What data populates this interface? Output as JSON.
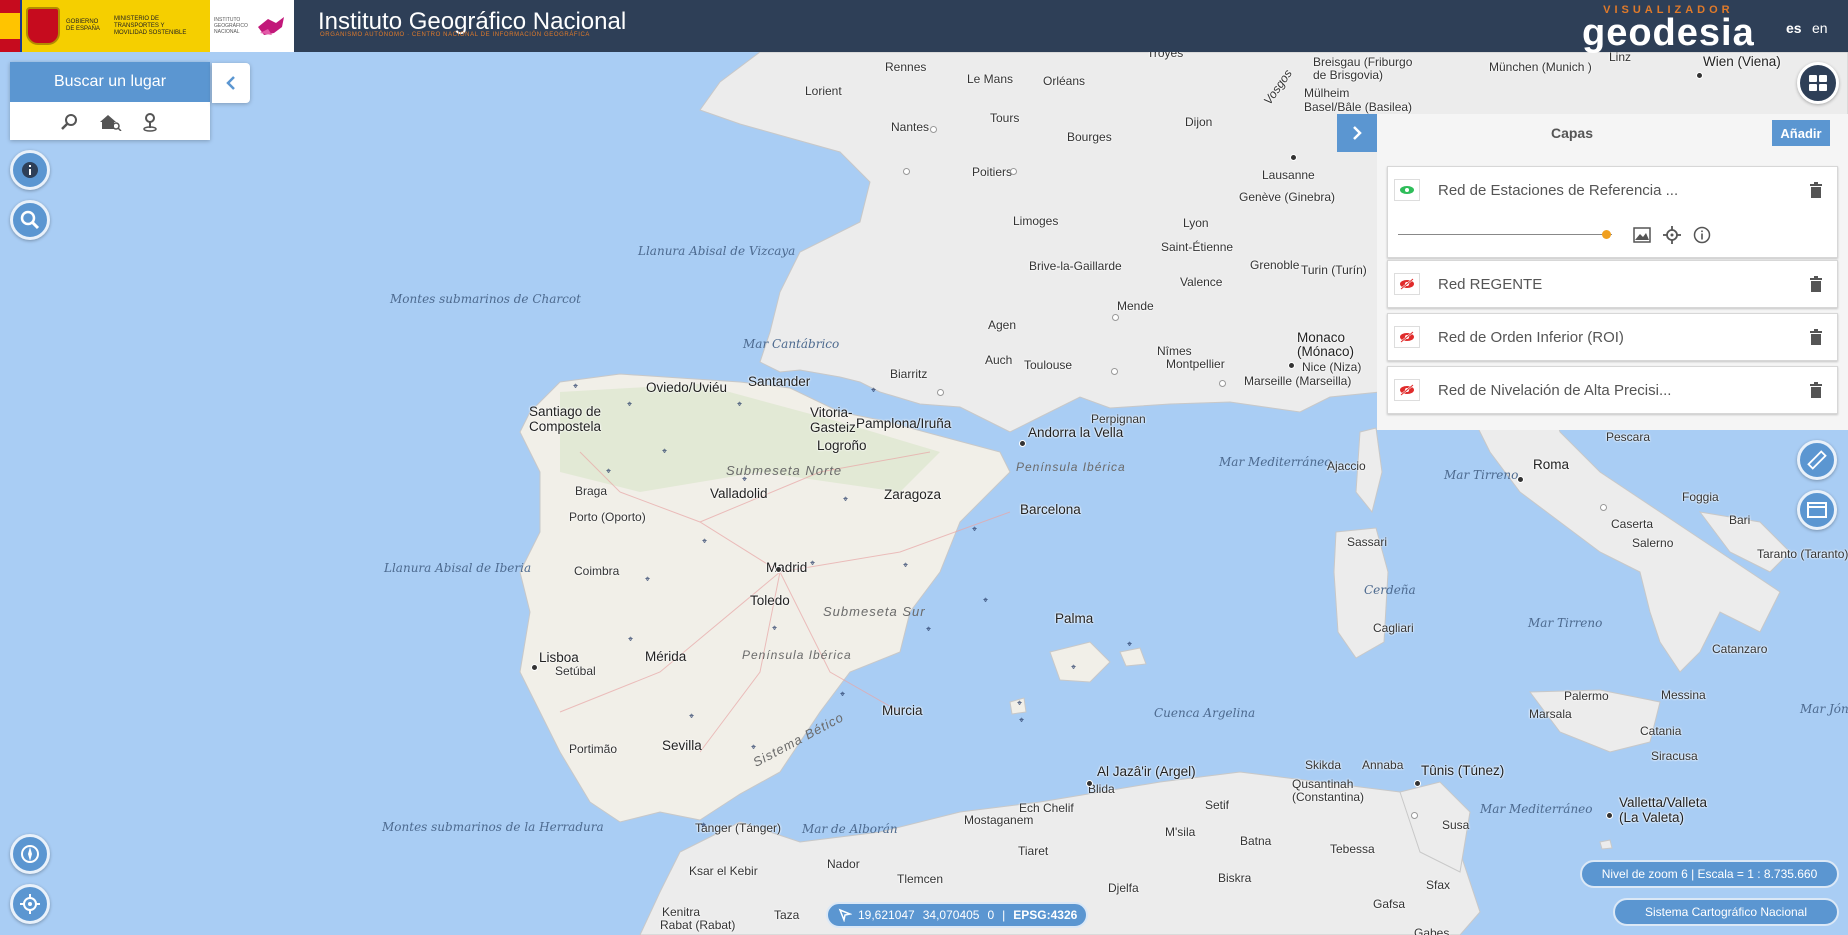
{
  "header": {
    "gov_label_1": "GOBIERNO DE ESPAÑA",
    "gov_label_2": "MINISTERIO DE TRANSPORTES Y MOVILIDAD SOSTENIBLE",
    "ign_small": "INSTITUTO GEOGRÁFICO NACIONAL",
    "institute_title_pre": "Instituto ",
    "institute_title_main": "Geográfico",
    "institute_title_post": " Nacional",
    "institute_subtitle": "ORGANISMO AUTÓNOMO · CENTRO NACIONAL DE INFORMACIÓN GEOGRÁFICA",
    "app_small": "VISUALIZADOR",
    "app_big": "geodesia",
    "lang_es": "es",
    "lang_en": "en"
  },
  "search": {
    "button_label": "Buscar un lugar"
  },
  "layers_panel": {
    "title": "Capas",
    "add_label": "Añadir",
    "layers": [
      {
        "name": "Red de Estaciones de Referencia ...",
        "visible": true
      },
      {
        "name": "Red REGENTE",
        "visible": false
      },
      {
        "name": "Red de Orden Inferior (ROI)",
        "visible": false
      },
      {
        "name": "Red de Nivelación de Alta Precisi...",
        "visible": false
      }
    ],
    "opacity": 0.97
  },
  "status": {
    "coord_x": "19,621047",
    "coord_y": "34,070405",
    "coord_z": "0",
    "epsg": "EPSG:4326",
    "scale_text": "Nivel de zoom 6 | Escala = 1 : 8.735.660",
    "credit_text": "Sistema Cartográfico Nacional"
  },
  "map": {
    "seas": [
      "Llanura Abisal de Vizcaya",
      "Montes submarinos de Charcot",
      "Mar Cantábrico",
      "Llanura Abisal de Iberia",
      "Montes submarinos de la Herradura",
      "Mar de Alborán",
      "Cuenca Argelina",
      "Mar Mediterráneo",
      "Mar Tirreno",
      "Mar Tirreno",
      "Mar Mediterráneo",
      "Mar Jón",
      "Cerdeña",
      "Vosgos"
    ],
    "regions": [
      "Submeseta Norte",
      "Submeseta Sur",
      "Península Ibérica",
      "Península Ibérica",
      "Sistema Bético"
    ],
    "places": [
      "Rennes",
      "Troyes",
      "Le Mans",
      "Orléans",
      "Lorient",
      "Nantes",
      "Tours",
      "Dijon",
      "Bourges",
      "Poitiers",
      "Lausanne",
      "Genève (Ginebra)",
      "Lyon",
      "Limoges",
      "Saint-Étienne",
      "Brive-la-Gaillarde",
      "Grenoble",
      "Valence",
      "Mende",
      "Agen",
      "Auch",
      "Toulouse",
      "Nîmes",
      "Montpellier",
      "Marseille (Marseilla)",
      "Nice (Niza)",
      "Monaco",
      "(Mónaco)",
      "Biarritz",
      "Andorra la Vella",
      "Perpignan",
      "Oviedo/Uviéu",
      "Santander",
      "Vitoria-",
      "Gasteiz",
      "Pamplona/Iruña",
      "Logroño",
      "Santiago de",
      "Compostela",
      "Braga",
      "Porto (Oporto)",
      "Valladolid",
      "Zaragoza",
      "Barcelona",
      "Coimbra",
      "Madrid",
      "Toledo",
      "Lisboa",
      "Setúbal",
      "Mérida",
      "Palma",
      "Murcia",
      "Portimão",
      "Sevilla",
      "Tanger (Tánger)",
      "Nador",
      "Ksar el Kebir",
      "Kenitra",
      "Rabat (Rabat)",
      "Taza",
      "Tlemcen",
      "Mostaganem",
      "Tiaret",
      "Djelfa",
      "Ech Chelif",
      "Blida",
      "Al Jazâ'ir (Argel)",
      "Setif",
      "M'sila",
      "Batna",
      "Biskra",
      "Skikda",
      "Annaba",
      "Qusantinah",
      "(Constantina)",
      "Tebessa",
      "Gafsa",
      "Sfax",
      "Tûnis (Túnez)",
      "Susa",
      "Valletta/Valleta",
      "(La Valeta)",
      "Roma",
      "Ajaccio",
      "Sassari",
      "Cagliari",
      "Caserta",
      "Salerno",
      "Foggia",
      "Bari",
      "Taranto (Taranto)",
      "Catanzaro",
      "Palermo",
      "Messina",
      "Marsala",
      "Catania",
      "Siracusa",
      "Pescara",
      "Wien (Viena)",
      "Linz",
      "München (Munich )",
      "Breisgau (Friburgo",
      "de Brisgovia)",
      "Mülheim",
      "Basel/Bâle (Basilea)",
      "Turin (Turín)",
      "Gabes"
    ]
  }
}
